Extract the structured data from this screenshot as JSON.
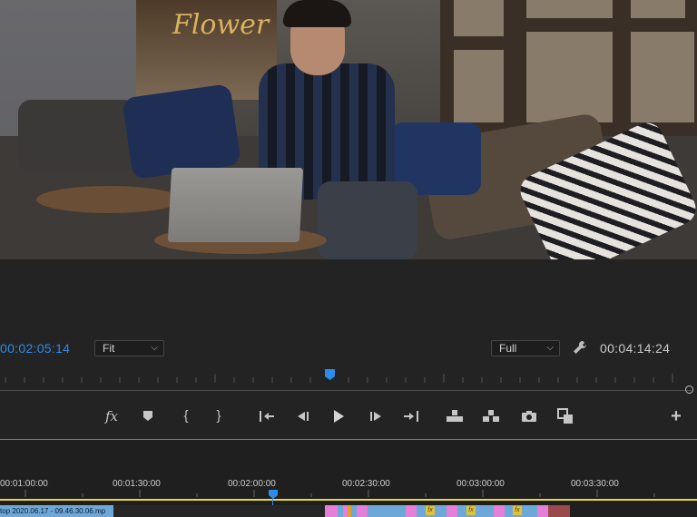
{
  "program_monitor": {
    "poster_text": "Flower",
    "current_timecode": "00:02:05:14",
    "zoom_select": "Fit",
    "quality_select": "Full",
    "duration_timecode": "00:04:14:24"
  },
  "colors": {
    "accent_blue": "#2d8ceb",
    "in_out_yellow": "#e7d83b",
    "clip_blue": "#6ea8d8",
    "clip_pink": "#e480d8",
    "fx_badge": "#e0c23a"
  },
  "transport_controls": [
    {
      "icon": "fx-icon",
      "label": "fx"
    },
    {
      "icon": "add-marker-icon"
    },
    {
      "icon": "mark-in-icon",
      "label": "{"
    },
    {
      "icon": "mark-out-icon",
      "label": "}"
    },
    {
      "icon": "go-to-in-icon"
    },
    {
      "icon": "step-back-icon"
    },
    {
      "icon": "play-icon"
    },
    {
      "icon": "step-forward-icon"
    },
    {
      "icon": "go-to-out-icon"
    },
    {
      "icon": "lift-icon"
    },
    {
      "icon": "extract-icon"
    },
    {
      "icon": "export-frame-icon"
    },
    {
      "icon": "comparison-view-icon"
    },
    {
      "icon": "button-editor-plus-icon",
      "label": "+"
    }
  ],
  "timeline": {
    "ruler_labels": [
      "00:01:00:00",
      "00:01:30:00",
      "00:02:00:00",
      "00:02:30:00",
      "00:03:00:00",
      "00:03:30:00"
    ],
    "clip_name": "top 2020.06.17 - 09.46.30.06.mp",
    "fx_badge": "fx"
  }
}
